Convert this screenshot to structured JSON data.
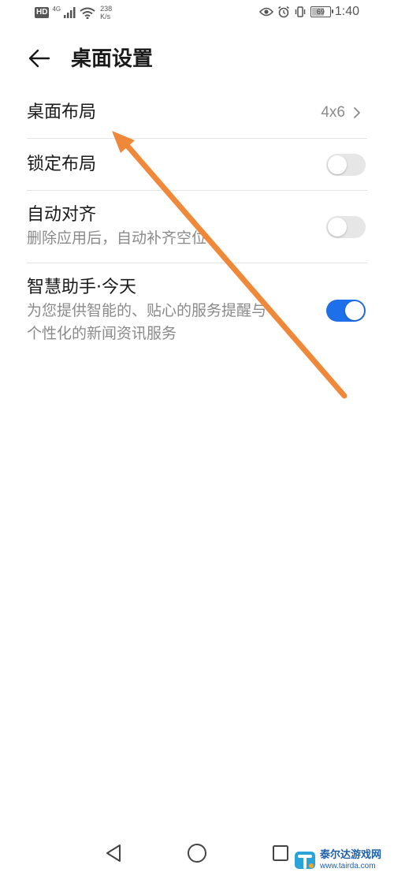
{
  "status_bar": {
    "hd_badge": "HD",
    "network_type": "4G",
    "speed_value": "238",
    "speed_unit": "K/s",
    "battery_level": "69",
    "battery_fraction": 0.69,
    "time": "1:40",
    "icons": [
      "signal-icon",
      "wifi-icon",
      "eye-icon",
      "alarm-icon",
      "vibrate-icon",
      "battery-icon"
    ]
  },
  "header": {
    "title": "桌面设置",
    "back_icon": "back-arrow-icon"
  },
  "settings": [
    {
      "title": "桌面布局",
      "value": "4x6",
      "control": "chevron"
    },
    {
      "title": "锁定布局",
      "control": "toggle",
      "on": false
    },
    {
      "title": "自动对齐",
      "subtitle": "删除应用后，自动补齐空位",
      "control": "toggle",
      "on": false
    },
    {
      "title": "智慧助手·今天",
      "subtitle_line1": "为您提供智能的、贴心的服务提醒与",
      "subtitle_line2": "个性化的新闻资讯服务",
      "control": "toggle",
      "on": true
    }
  ],
  "colors": {
    "toggle_on": "#1e6fea",
    "toggle_off": "#e6e6e6",
    "annotation_arrow": "#f0883a"
  },
  "nav_bar": {
    "icons": [
      "back-triangle-icon",
      "home-circle-icon",
      "recents-square-icon"
    ]
  },
  "watermark": {
    "name": "泰尔达游戏网",
    "url": "www.tairda.com"
  }
}
